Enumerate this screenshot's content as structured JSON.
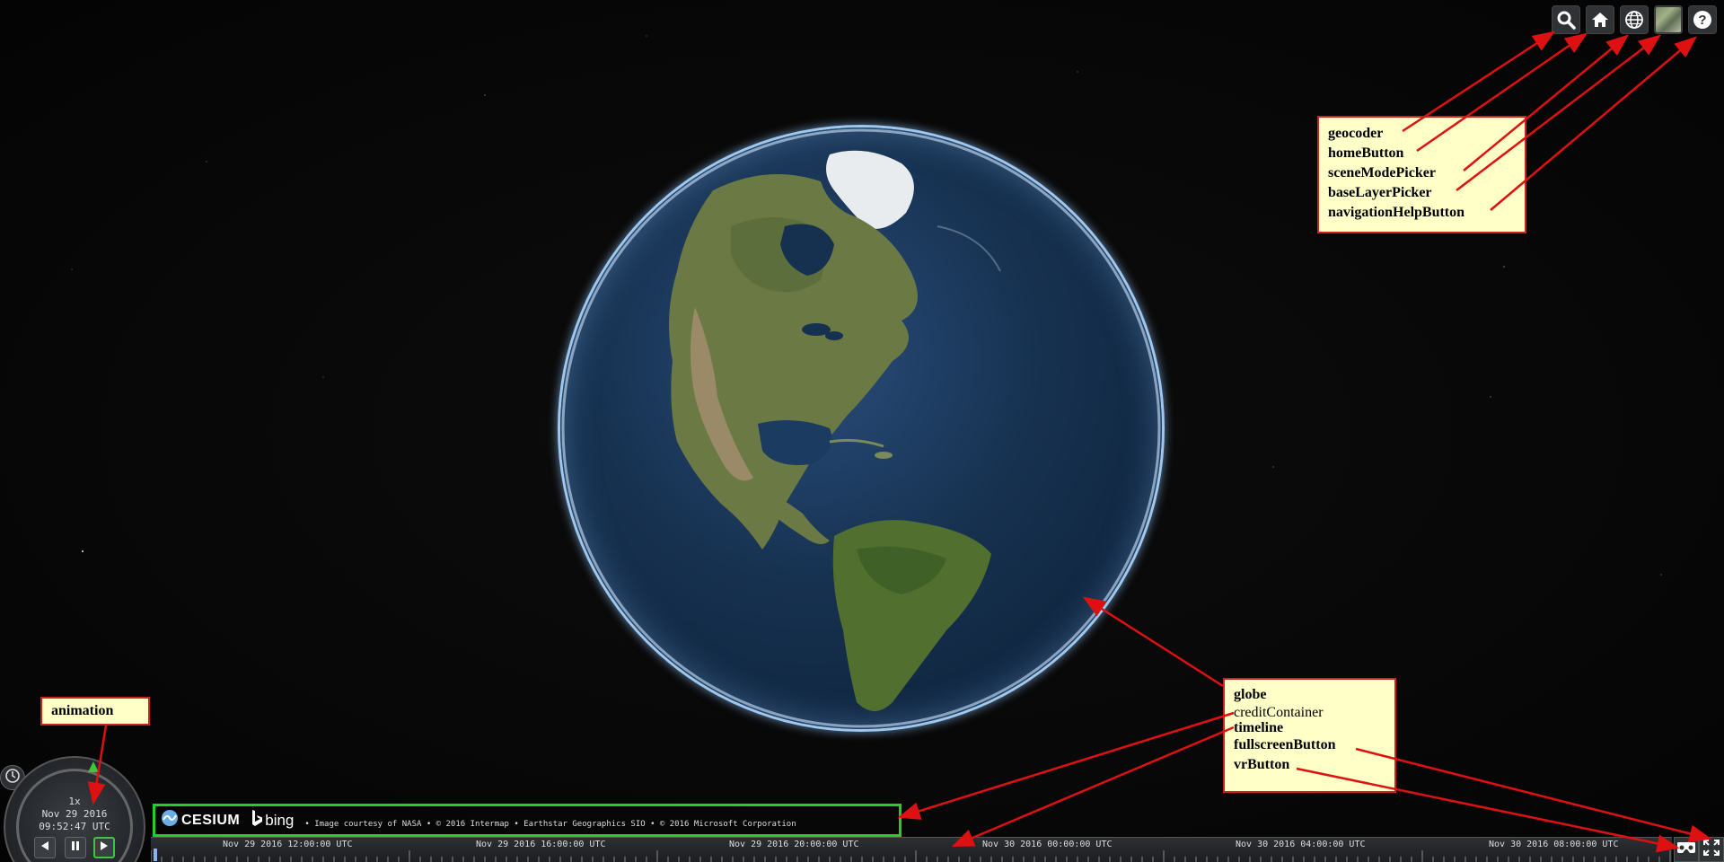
{
  "toolbar": {
    "buttons": [
      {
        "name": "geocoder",
        "icon": "search-icon"
      },
      {
        "name": "homeButton",
        "icon": "home-icon"
      },
      {
        "name": "sceneModePicker",
        "icon": "globe-icon"
      },
      {
        "name": "baseLayerPicker",
        "icon": "imagery-thumbnail-icon"
      },
      {
        "name": "navigationHelpButton",
        "icon": "help-icon"
      }
    ]
  },
  "annotations": {
    "top_box": [
      "geocoder",
      "homeButton",
      "sceneModePicker",
      "baseLayerPicker",
      "navigationHelpButton"
    ],
    "bottom_box": [
      "globe",
      "creditContainer",
      "timeline",
      "fullscreenButton",
      "vrButton"
    ],
    "animation_label": "animation",
    "arrow_color": "#dd1111"
  },
  "animation": {
    "speed": "1x",
    "date": "Nov 29 2016",
    "time": "09:52:47 UTC"
  },
  "credits": {
    "cesium_logo": "CESIUM",
    "bing_logo": "bing",
    "text": "• Image courtesy of NASA • © 2016 Intermap • Earthstar Geographics SIO • © 2016 Microsoft Corporation",
    "highlight_color": "#22d022"
  },
  "timeline": {
    "labels": [
      "Nov 29 2016 12:00:00 UTC",
      "Nov 29 2016 16:00:00 UTC",
      "Nov 29 2016 20:00:00 UTC",
      "Nov 30 2016 00:00:00 UTC",
      "Nov 30 2016 04:00:00 UTC",
      "Nov 30 2016 08:00:00 UTC"
    ]
  },
  "colors": {
    "background": "#050505",
    "globe_halo": "#9ec8f0",
    "note_fill": "#ffffc8"
  }
}
